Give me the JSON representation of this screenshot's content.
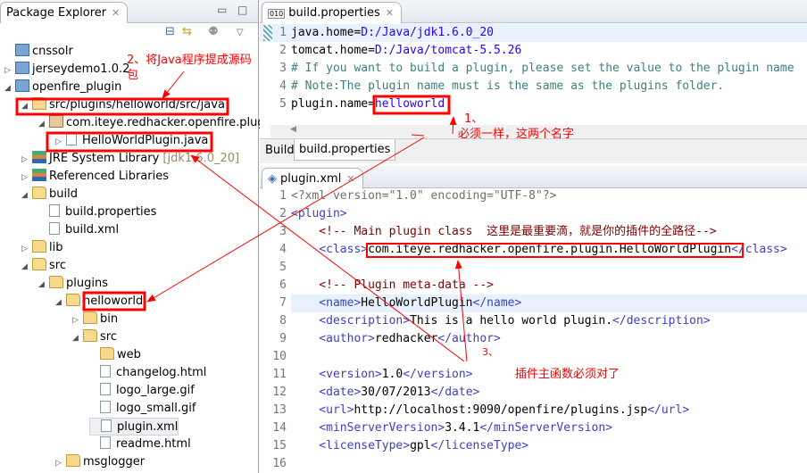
{
  "explorer": {
    "title": "Package Explorer",
    "items": [
      {
        "label": "cnssolr",
        "arrow": "",
        "icon": "project-icon"
      },
      {
        "label": "jerseydemo1.0.2",
        "arrow": "▷",
        "icon": "project-icon"
      },
      {
        "label": "openfire_plugin",
        "arrow": "◢",
        "icon": "project-icon"
      },
      {
        "label": "src/plugins/helloworld/src/java",
        "arrow": "◢",
        "icon": "source-folder-icon"
      },
      {
        "label": "com.iteye.redhacker.openfire.plugin",
        "arrow": "◢",
        "icon": "package-icon"
      },
      {
        "label": "HelloWorldPlugin.java",
        "arrow": "▷",
        "icon": "java-file-icon"
      },
      {
        "label": "JRE System Library",
        "suffix": "[jdk1.6.0_20]",
        "arrow": "▷",
        "icon": "library-icon"
      },
      {
        "label": "Referenced Libraries",
        "arrow": "▷",
        "icon": "library-icon"
      },
      {
        "label": "build",
        "arrow": "◢",
        "icon": "folder-icon"
      },
      {
        "label": "build.properties",
        "arrow": "",
        "icon": "properties-file-icon"
      },
      {
        "label": "build.xml",
        "arrow": "",
        "icon": "ant-file-icon"
      },
      {
        "label": "lib",
        "arrow": "▷",
        "icon": "folder-icon"
      },
      {
        "label": "src",
        "arrow": "◢",
        "icon": "folder-icon"
      },
      {
        "label": "plugins",
        "arrow": "◢",
        "icon": "folder-icon"
      },
      {
        "label": "helloworld",
        "arrow": "◢",
        "icon": "folder-icon"
      },
      {
        "label": "bin",
        "arrow": "▷",
        "icon": "folder-icon"
      },
      {
        "label": "src",
        "arrow": "◢",
        "icon": "folder-icon"
      },
      {
        "label": "web",
        "arrow": "",
        "icon": "folder-icon"
      },
      {
        "label": "changelog.html",
        "arrow": "",
        "icon": "html-file-icon"
      },
      {
        "label": "logo_large.gif",
        "arrow": "",
        "icon": "image-file-icon"
      },
      {
        "label": "logo_small.gif",
        "arrow": "",
        "icon": "image-file-icon"
      },
      {
        "label": "plugin.xml",
        "arrow": "",
        "icon": "plugin-file-icon"
      },
      {
        "label": "readme.html",
        "arrow": "",
        "icon": "html-file-icon"
      },
      {
        "label": "msglogger",
        "arrow": "▷",
        "icon": "folder-icon"
      }
    ]
  },
  "editor1": {
    "tab": "build.properties",
    "bottom_tabs": [
      "Build",
      "build.properties"
    ],
    "lines": [
      {
        "n": "1",
        "key": "java.home=",
        "val": "D:/Java/jdk1.6.0_20"
      },
      {
        "n": "2",
        "key": "tomcat.home=",
        "val": "D:/Java/tomcat-5.5.26"
      },
      {
        "n": "3",
        "comment": "# If you want to build a plugin, please set the value to the plugin name"
      },
      {
        "n": "4",
        "comment": "# Note:The plugin name must is the same as the plugins folder."
      },
      {
        "n": "5",
        "key": "plugin.name=",
        "val": "helloworld"
      }
    ]
  },
  "editor2": {
    "tab": "plugin.xml",
    "lines": [
      {
        "n": "1",
        "text": "<?xml version=\"1.0\" encoding=\"UTF-8\"?>",
        "cls": "pi"
      },
      {
        "n": "2",
        "text": "<plugin>",
        "cls": "tag"
      },
      {
        "n": "3",
        "text": "    <!-- Main plugin class  这里是最重要滴，就是你的插件的全路径-->",
        "cls": "xcom"
      },
      {
        "n": "4",
        "pre": "    <class>",
        "body": "com.iteye.redhacker.openfire.plugin.HelloWorldPlugin",
        "post": "</class>"
      },
      {
        "n": "5",
        "text": ""
      },
      {
        "n": "6",
        "text": "    <!-- Plugin meta-data -->",
        "cls": "xcom"
      },
      {
        "n": "7",
        "pre": "    <name>",
        "body": "HelloWorldPlugin",
        "post": "</name>"
      },
      {
        "n": "8",
        "pre": "    <description>",
        "body": "This is a hello world plugin.",
        "post": "</description>"
      },
      {
        "n": "9",
        "pre": "    <author>",
        "body": "redhacker",
        "post": "</author>"
      },
      {
        "n": "10",
        "text": ""
      },
      {
        "n": "11",
        "pre": "    <version>",
        "body": "1.0",
        "post": "</version>"
      },
      {
        "n": "12",
        "pre": "    <date>",
        "body": "30/07/2013",
        "post": "</date>"
      },
      {
        "n": "13",
        "pre": "    <url>",
        "body": "http://localhost:9090/openfire/plugins.jsp",
        "post": "</url>"
      },
      {
        "n": "14",
        "pre": "    <minServerVersion>",
        "body": "3.4.1",
        "post": "</minServerVersion>"
      },
      {
        "n": "15",
        "pre": "    <licenseType>",
        "body": "gpl",
        "post": "</licenseType>"
      },
      {
        "n": "16",
        "text": ""
      }
    ]
  },
  "annotations": {
    "a1_num": "1、",
    "a1_text": "必须一样，这两个名字",
    "a2_line1": "2、将Java程序提成源码",
    "a2_line2": "包",
    "a3_num": "3、",
    "a3_text": "插件主函数必须对了"
  },
  "colors": {
    "annotation": "#ff0000",
    "keyword_value": "#2a00ff"
  }
}
